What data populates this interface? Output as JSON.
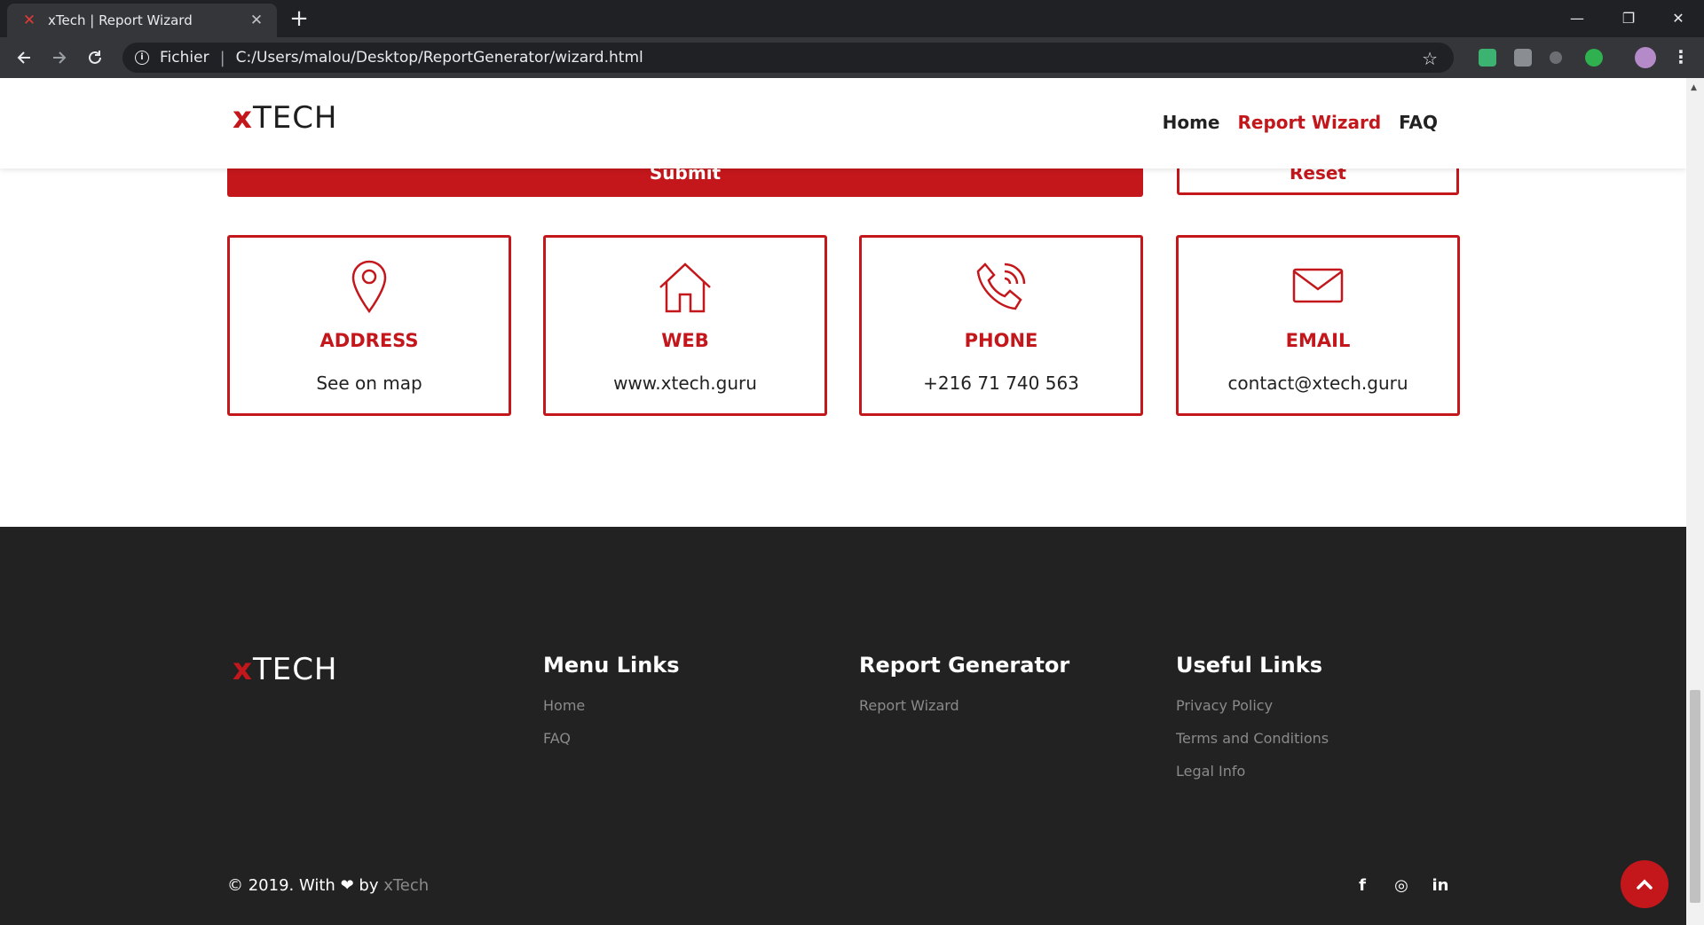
{
  "browser": {
    "tab_title": "xTech | Report Wizard",
    "tab_favicon": "✕",
    "new_tab": "+",
    "scheme_label": "Fichier",
    "url": "C:/Users/malou/Desktop/ReportGenerator/wizard.html"
  },
  "header": {
    "logo_x": "x",
    "logo_text": "TECH",
    "nav": {
      "home": "Home",
      "report_wizard": "Report Wizard",
      "faq": "FAQ"
    }
  },
  "form": {
    "submit_label": "Submit",
    "reset_label": "Reset"
  },
  "contact": {
    "address": {
      "title": "ADDRESS",
      "value": "See on map"
    },
    "web": {
      "title": "WEB",
      "value": "www.xtech.guru"
    },
    "phone": {
      "title": "PHONE",
      "value": "+216 71 740 563"
    },
    "email": {
      "title": "EMAIL",
      "value": "contact@xtech.guru"
    }
  },
  "footer": {
    "logo_x": "x",
    "logo_text": "TECH",
    "menu_links": {
      "heading": "Menu Links",
      "home": "Home",
      "faq": "FAQ"
    },
    "report_generator": {
      "heading": "Report Generator",
      "report_wizard": "Report Wizard"
    },
    "useful_links": {
      "heading": "Useful Links",
      "privacy": "Privacy Policy",
      "terms": "Terms and Conditions",
      "legal": "Legal Info"
    },
    "copyright_prefix": "© 2019. With",
    "copyright_by": "by",
    "copyright_brand": "xTech",
    "social": {
      "facebook": "f",
      "instagram": "◎",
      "linkedin": "in"
    }
  },
  "colors": {
    "brand_red": "#c4171c",
    "footer_bg": "#222222",
    "chrome_dark": "#202124"
  }
}
